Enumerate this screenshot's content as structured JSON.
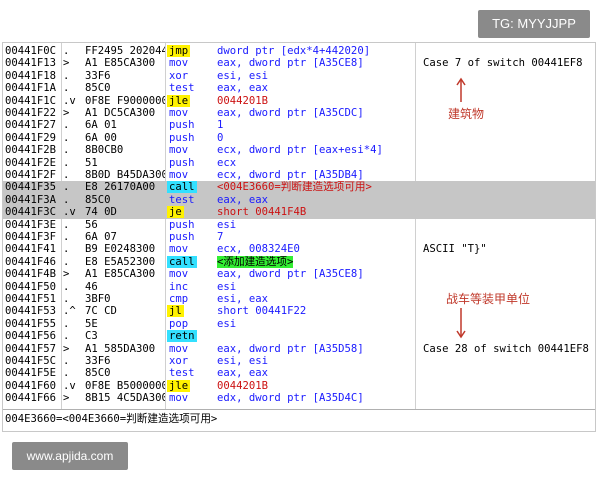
{
  "watermarks": {
    "tg": "TG: MYYJJPP",
    "site": "www.apjida.com"
  },
  "colors": {
    "yellow": "#fff200",
    "cyan": "#33e0ff",
    "green": "#33ee33",
    "blue": "#1a1aff",
    "red": "#cc1111",
    "selected_row": "#c6c6c6"
  },
  "rows": [
    {
      "addr": "00441F0C",
      "mark": ".",
      "hex": "FF2495 2020441",
      "mn": "jmp",
      "hl": "yellow",
      "op": "dword ptr [edx*4+442020]",
      "opc": "black",
      "comment": ""
    },
    {
      "addr": "00441F13",
      "mark": ">",
      "hex": "A1 E85CA300",
      "mn": "mov",
      "hl": "",
      "op": "eax, dword ptr [A35CE8]",
      "opc": "black",
      "comment": "Case 7 of switch 00441EF8"
    },
    {
      "addr": "00441F18",
      "mark": ".",
      "hex": "33F6",
      "mn": "xor",
      "hl": "",
      "op": "esi, esi",
      "opc": "black",
      "comment": ""
    },
    {
      "addr": "00441F1A",
      "mark": ".",
      "hex": "85C0",
      "mn": "test",
      "hl": "",
      "op": "eax, eax",
      "opc": "black",
      "comment": ""
    },
    {
      "addr": "00441F1C",
      "mark": ".v",
      "hex": "0F8E F9000000",
      "mn": "jle",
      "hl": "yellow",
      "op": "0044201B",
      "opc": "red",
      "comment": ""
    },
    {
      "addr": "00441F22",
      "mark": ">",
      "hex": "A1 DC5CA300",
      "mn": "mov",
      "hl": "",
      "op": "eax, dword ptr [A35CDC]",
      "opc": "black",
      "comment": ""
    },
    {
      "addr": "00441F27",
      "mark": ".",
      "hex": "6A 01",
      "mn": "push",
      "hl": "",
      "op": "1",
      "opc": "black",
      "comment": ""
    },
    {
      "addr": "00441F29",
      "mark": ".",
      "hex": "6A 00",
      "mn": "push",
      "hl": "",
      "op": "0",
      "opc": "black",
      "comment": ""
    },
    {
      "addr": "00441F2B",
      "mark": ".",
      "hex": "8B0CB0",
      "mn": "mov",
      "hl": "",
      "op": "ecx, dword ptr [eax+esi*4]",
      "opc": "black",
      "comment": ""
    },
    {
      "addr": "00441F2E",
      "mark": ".",
      "hex": "51",
      "mn": "push",
      "hl": "",
      "op": "ecx",
      "opc": "black",
      "comment": ""
    },
    {
      "addr": "00441F2F",
      "mark": ".",
      "hex": "8B0D B45DA300",
      "mn": "mov",
      "hl": "",
      "op": "ecx, dword ptr [A35DB4]",
      "opc": "black",
      "comment": ""
    },
    {
      "addr": "00441F35",
      "mark": ".",
      "hex": "E8 26170A00",
      "mn": "call",
      "hl": "cyan",
      "op": "<004E3660=判断建造选项可用>",
      "opc": "red",
      "comment": "",
      "sel": true
    },
    {
      "addr": "00441F3A",
      "mark": ".",
      "hex": "85C0",
      "mn": "test",
      "hl": "",
      "op": "eax, eax",
      "opc": "black",
      "comment": "",
      "sel": true
    },
    {
      "addr": "00441F3C",
      "mark": ".v",
      "hex": "74 0D",
      "mn": "je",
      "hl": "yellow",
      "op": "short 00441F4B",
      "opc": "red",
      "comment": "",
      "sel": true
    },
    {
      "addr": "00441F3E",
      "mark": ".",
      "hex": "56",
      "mn": "push",
      "hl": "",
      "op": "esi",
      "opc": "black",
      "comment": ""
    },
    {
      "addr": "00441F3F",
      "mark": ".",
      "hex": "6A 07",
      "mn": "push",
      "hl": "",
      "op": "7",
      "opc": "black",
      "comment": ""
    },
    {
      "addr": "00441F41",
      "mark": ".",
      "hex": "B9 E0248300",
      "mn": "mov",
      "hl": "",
      "op": "ecx, 008324E0",
      "opc": "black",
      "comment": "ASCII \"T}\""
    },
    {
      "addr": "00441F46",
      "mark": ".",
      "hex": "E8 E5A52300",
      "mn": "call",
      "hl": "cyan",
      "op": "<添加建造选项>",
      "opc": "black",
      "ophl": "green",
      "comment": ""
    },
    {
      "addr": "00441F4B",
      "mark": ">",
      "hex": "A1 E85CA300",
      "mn": "mov",
      "hl": "",
      "op": "eax, dword ptr [A35CE8]",
      "opc": "black",
      "comment": ""
    },
    {
      "addr": "00441F50",
      "mark": ".",
      "hex": "46",
      "mn": "inc",
      "hl": "",
      "op": "esi",
      "opc": "black",
      "comment": ""
    },
    {
      "addr": "00441F51",
      "mark": ".",
      "hex": "3BF0",
      "mn": "cmp",
      "hl": "",
      "op": "esi, eax",
      "opc": "black",
      "comment": ""
    },
    {
      "addr": "00441F53",
      "mark": ".^",
      "hex": "7C CD",
      "mn": "jl",
      "hl": "yellow",
      "op": "short 00441F22",
      "opc": "black",
      "comment": ""
    },
    {
      "addr": "00441F55",
      "mark": ".",
      "hex": "5E",
      "mn": "pop",
      "hl": "",
      "op": "esi",
      "opc": "black",
      "comment": ""
    },
    {
      "addr": "00441F56",
      "mark": ".",
      "hex": "C3",
      "mn": "retn",
      "hl": "cyan",
      "op": "",
      "opc": "black",
      "comment": ""
    },
    {
      "addr": "00441F57",
      "mark": ">",
      "hex": "A1 585DA300",
      "mn": "mov",
      "hl": "",
      "op": "eax, dword ptr [A35D58]",
      "opc": "black",
      "comment": "Case 28 of switch 00441EF8"
    },
    {
      "addr": "00441F5C",
      "mark": ".",
      "hex": "33F6",
      "mn": "xor",
      "hl": "",
      "op": "esi, esi",
      "opc": "black",
      "comment": ""
    },
    {
      "addr": "00441F5E",
      "mark": ".",
      "hex": "85C0",
      "mn": "test",
      "hl": "",
      "op": "eax, eax",
      "opc": "black",
      "comment": ""
    },
    {
      "addr": "00441F60",
      "mark": ".v",
      "hex": "0F8E B5000000",
      "mn": "jle",
      "hl": "yellow",
      "op": "0044201B",
      "opc": "red",
      "comment": ""
    },
    {
      "addr": "00441F66",
      "mark": ">",
      "hex": "8B15 4C5DA300",
      "mn": "mov",
      "hl": "",
      "op": "edx, dword ptr [A35D4C]",
      "opc": "black",
      "comment": ""
    }
  ],
  "status": "004E3660=<004E3660=判断建造选项可用>",
  "annotations": {
    "buildings": "建筑物",
    "armored": "战车等装甲单位"
  }
}
